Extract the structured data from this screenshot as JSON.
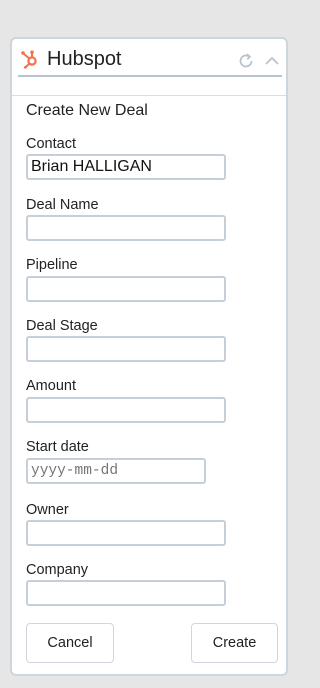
{
  "widget": {
    "title": "Hubspot",
    "logo_icon": "hubspot-sprocket-icon",
    "brand_color": "#f2734f",
    "header_icons": [
      "refresh-icon",
      "chevron-up-icon"
    ]
  },
  "form": {
    "title": "Create New Deal",
    "fields": {
      "contact": {
        "label": "Contact",
        "value": "Brian HALLIGAN"
      },
      "deal_name": {
        "label": "Deal Name",
        "value": ""
      },
      "pipeline": {
        "label": "Pipeline",
        "value": ""
      },
      "deal_stage": {
        "label": "Deal Stage",
        "value": ""
      },
      "amount": {
        "label": "Amount",
        "value": ""
      },
      "start_date": {
        "label": "Start date",
        "value": "",
        "placeholder": "yyyy-mm-dd"
      },
      "owner": {
        "label": "Owner",
        "value": ""
      },
      "company": {
        "label": "Company",
        "value": ""
      }
    },
    "buttons": {
      "cancel": "Cancel",
      "create": "Create"
    }
  }
}
